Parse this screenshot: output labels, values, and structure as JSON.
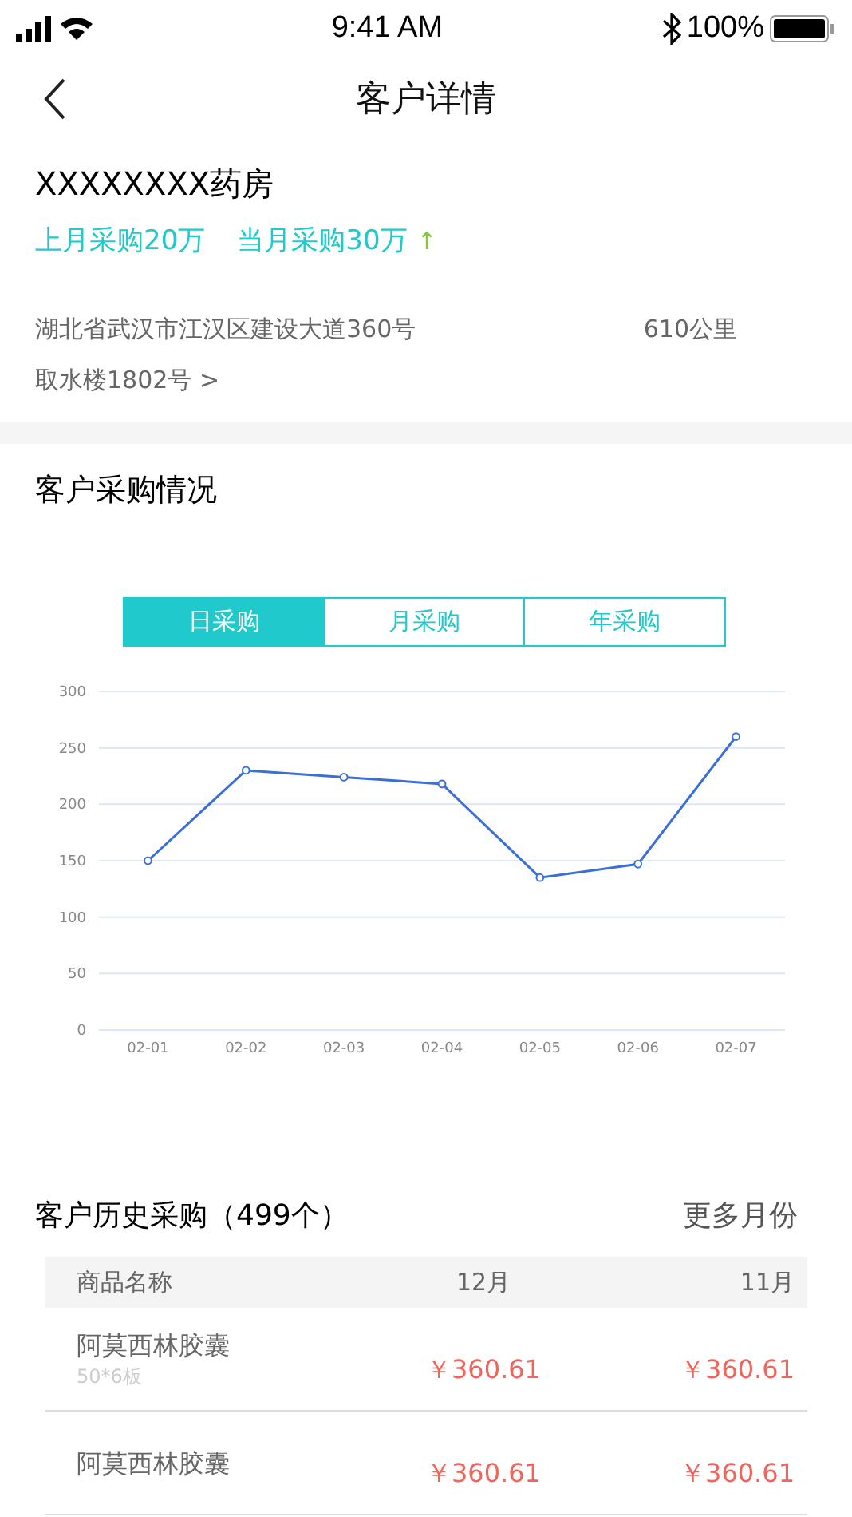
{
  "status_bar": {
    "time": "9:41 AM",
    "battery": "100%"
  },
  "nav": {
    "title": "客户详情"
  },
  "customer": {
    "name": "XXXXXXXX药房",
    "last_month": "上月采购20万",
    "this_month": "当月采购30万",
    "trend_arrow": "↑",
    "address_line1": "湖北省武汉市江汉区建设大道360号",
    "address_line2": "取水楼1802号 >",
    "distance": "610公里"
  },
  "purchase_section": {
    "title": "客户采购情况",
    "tabs": [
      {
        "label": "日采购",
        "selected": true
      },
      {
        "label": "月采购",
        "selected": false
      },
      {
        "label": "年采购",
        "selected": false
      }
    ],
    "chart_data": {
      "type": "line",
      "categories": [
        "02-01",
        "02-02",
        "02-03",
        "02-04",
        "02-05",
        "02-06",
        "02-07"
      ],
      "ylim": [
        0,
        300
      ],
      "yticks": [
        0,
        50,
        100,
        150,
        200,
        250,
        300
      ],
      "grid": true,
      "series": [
        {
          "color": "#3a6fd8",
          "marker": "circle",
          "values": [
            150,
            230,
            224,
            218,
            135,
            147,
            260
          ]
        }
      ]
    }
  },
  "history": {
    "title": "客户历史采购（499个）",
    "more": "更多月份",
    "columns": [
      "商品名称",
      "12月",
      "11月"
    ],
    "rows": [
      {
        "name": "阿莫西林胶囊",
        "spec": "50*6板",
        "col_12": "￥360.61",
        "col_11": "￥360.61"
      },
      {
        "name": "阿莫西林胶囊",
        "col_12": "￥360.61",
        "col_11": "￥360.61"
      }
    ]
  }
}
